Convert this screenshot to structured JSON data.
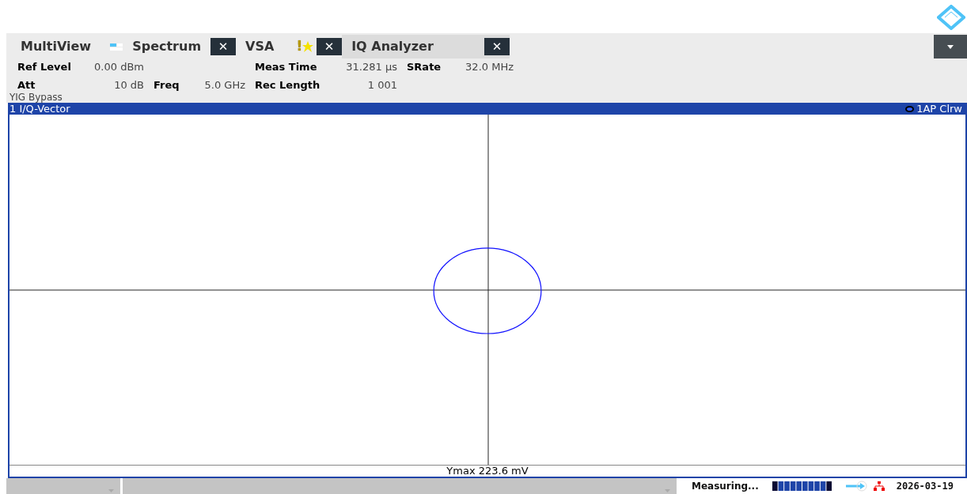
{
  "tabs": [
    {
      "label": "MultiView",
      "kind": "multiview",
      "selected": false
    },
    {
      "label": "Spectrum",
      "kind": "channel",
      "selected": false
    },
    {
      "label": "VSA",
      "kind": "channel",
      "warning": "!",
      "selected": false
    },
    {
      "label": "IQ Analyzer",
      "kind": "channel",
      "selected": true
    }
  ],
  "close_label": "✕",
  "settings": [
    [
      {
        "label": "Ref Level",
        "value": "0.00 dBm"
      },
      {
        "label": "Meas Time",
        "value": "31.281 µs"
      },
      {
        "label": "SRate",
        "value": "32.0 MHz"
      }
    ],
    [
      {
        "label": "Att",
        "value": "10 dB"
      },
      {
        "label": "Freq",
        "value": "5.0 GHz"
      },
      {
        "label": "Rec Length",
        "value": "1 001"
      }
    ]
  ],
  "note": "YIG Bypass",
  "window": {
    "title": "1 I/Q-Vector",
    "trace": "1AP Clrw",
    "footer": "Ymax 223.6 mV"
  },
  "status_bar": {
    "message": "Measuring...",
    "date": "2026-03-19"
  }
}
